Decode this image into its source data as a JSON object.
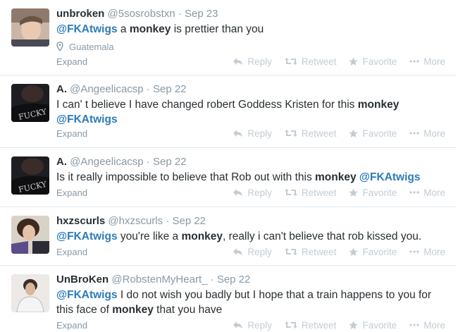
{
  "tweets": [
    {
      "fullname": "unbroken",
      "username": "@5sosrobstxn",
      "time": "Sep 23",
      "text": [
        {
          "t": "@FKAtwigs",
          "k": "mention"
        },
        {
          "t": " a ",
          "k": ""
        },
        {
          "t": "monkey",
          "k": "kw"
        },
        {
          "t": " is prettier than you",
          "k": ""
        }
      ],
      "location": "Guatemala",
      "expand_label": "Expand"
    },
    {
      "fullname": "A.",
      "username": "@Angeelicacsp",
      "time": "Sep 22",
      "text": [
        {
          "t": "I can' t believe I have changed robert Goddess Kristen for this ",
          "k": ""
        },
        {
          "t": "monkey",
          "k": "kw"
        },
        {
          "t": " ",
          "k": ""
        },
        {
          "t": "@FKAtwigs",
          "k": "mention"
        }
      ],
      "expand_label": "Expand"
    },
    {
      "fullname": "A.",
      "username": "@Angeelicacsp",
      "time": "Sep 22",
      "text": [
        {
          "t": "Is it really impossible to believe that Rob out with this ",
          "k": ""
        },
        {
          "t": "monkey",
          "k": "kw"
        },
        {
          "t": " ",
          "k": ""
        },
        {
          "t": "@FKAtwigs",
          "k": "mention"
        }
      ],
      "expand_label": "Expand"
    },
    {
      "fullname": "hxzscurls",
      "username": "@hxzscurls",
      "time": "Sep 22",
      "text": [
        {
          "t": "@FKAtwigs",
          "k": "mention"
        },
        {
          "t": " you're like a ",
          "k": ""
        },
        {
          "t": "monkey",
          "k": "kw"
        },
        {
          "t": ", really i can't believe that rob kissed you.",
          "k": ""
        }
      ],
      "expand_label": "Expand"
    },
    {
      "fullname": "UnBroKen",
      "username": "@RobstenMyHeart_",
      "time": "Sep 22",
      "text": [
        {
          "t": "@FKAtwigs",
          "k": "mention"
        },
        {
          "t": " I do not wish you badly but I hope that a train happens to you for this face of ",
          "k": ""
        },
        {
          "t": "monkey",
          "k": "kw"
        },
        {
          "t": " that you have",
          "k": ""
        }
      ],
      "expand_label": "Expand"
    }
  ],
  "actions": {
    "reply_label": "Reply",
    "retweet_label": "Retweet",
    "favorite_label": "Favorite",
    "more_label": "More"
  },
  "colors": {
    "mention": "#2b7bb9",
    "muted": "#8899a6",
    "action": "#c3ccd3",
    "divider": "#e1e8ed"
  },
  "icons": {
    "location": "map-pin-icon",
    "reply": "reply-icon",
    "retweet": "retweet-icon",
    "favorite": "star-icon",
    "more": "ellipsis-icon"
  }
}
